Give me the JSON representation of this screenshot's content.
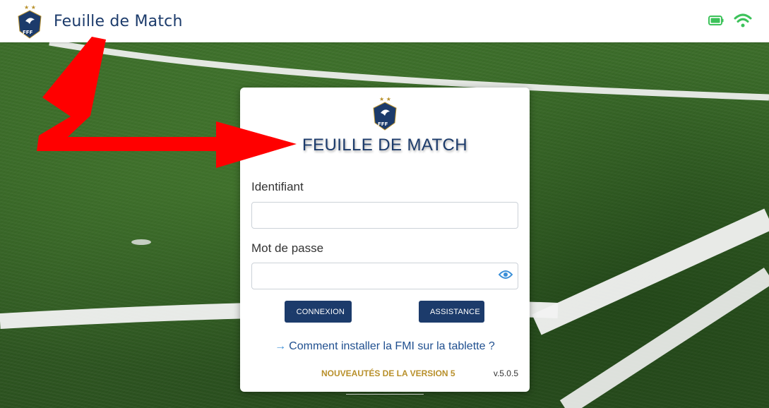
{
  "header": {
    "title": "Feuille de Match",
    "logo": "fff-crest-icon",
    "status_icons": [
      "battery-icon",
      "wifi-icon"
    ],
    "status_color": "#3cc25a"
  },
  "login_card": {
    "logo": "fff-crest-icon",
    "title": "FEUILLE DE MATCH",
    "username_label": "Identifiant",
    "username_value": "",
    "password_label": "Mot de passe",
    "password_value": "",
    "password_toggle_icon": "eye-icon",
    "connexion_button": "CONNEXION",
    "assistance_button": "ASSISTANCE",
    "install_link": "Comment installer la FMI sur la tablette ?",
    "news_link": "NOUVEAUTÉS DE LA VERSION 5",
    "version": "v.5.0.5"
  },
  "colors": {
    "brand_navy": "#1c3b6b",
    "gold": "#b8902b",
    "link_blue": "#1f4f8f",
    "annotation_red": "#ff0000"
  }
}
